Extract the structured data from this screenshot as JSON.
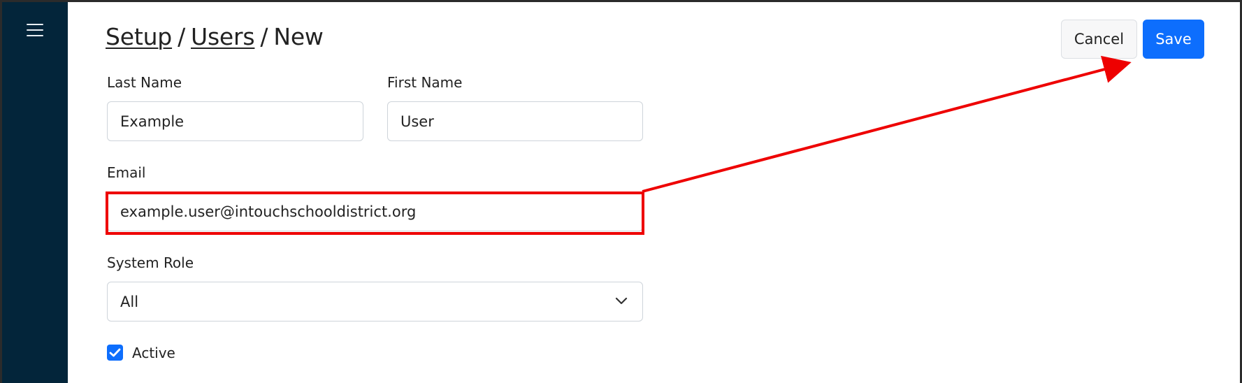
{
  "breadcrumb": {
    "items": [
      "Setup",
      "Users"
    ],
    "current": "New",
    "separator": "/"
  },
  "actions": {
    "cancel_label": "Cancel",
    "save_label": "Save"
  },
  "form": {
    "last_name": {
      "label": "Last Name",
      "value": "Example"
    },
    "first_name": {
      "label": "First Name",
      "value": "User"
    },
    "email": {
      "label": "Email",
      "value": "example.user@intouchschooldistrict.org"
    },
    "system_role": {
      "label": "System Role",
      "selected": "All"
    },
    "active": {
      "label": "Active",
      "checked": true
    }
  },
  "icons": {
    "menu": "hamburger-icon",
    "select_chevron": "chevron-down-icon",
    "check": "check-icon"
  },
  "colors": {
    "sidebar": "#03253a",
    "primary": "#0d6efd",
    "annotation": "#ee0000"
  }
}
